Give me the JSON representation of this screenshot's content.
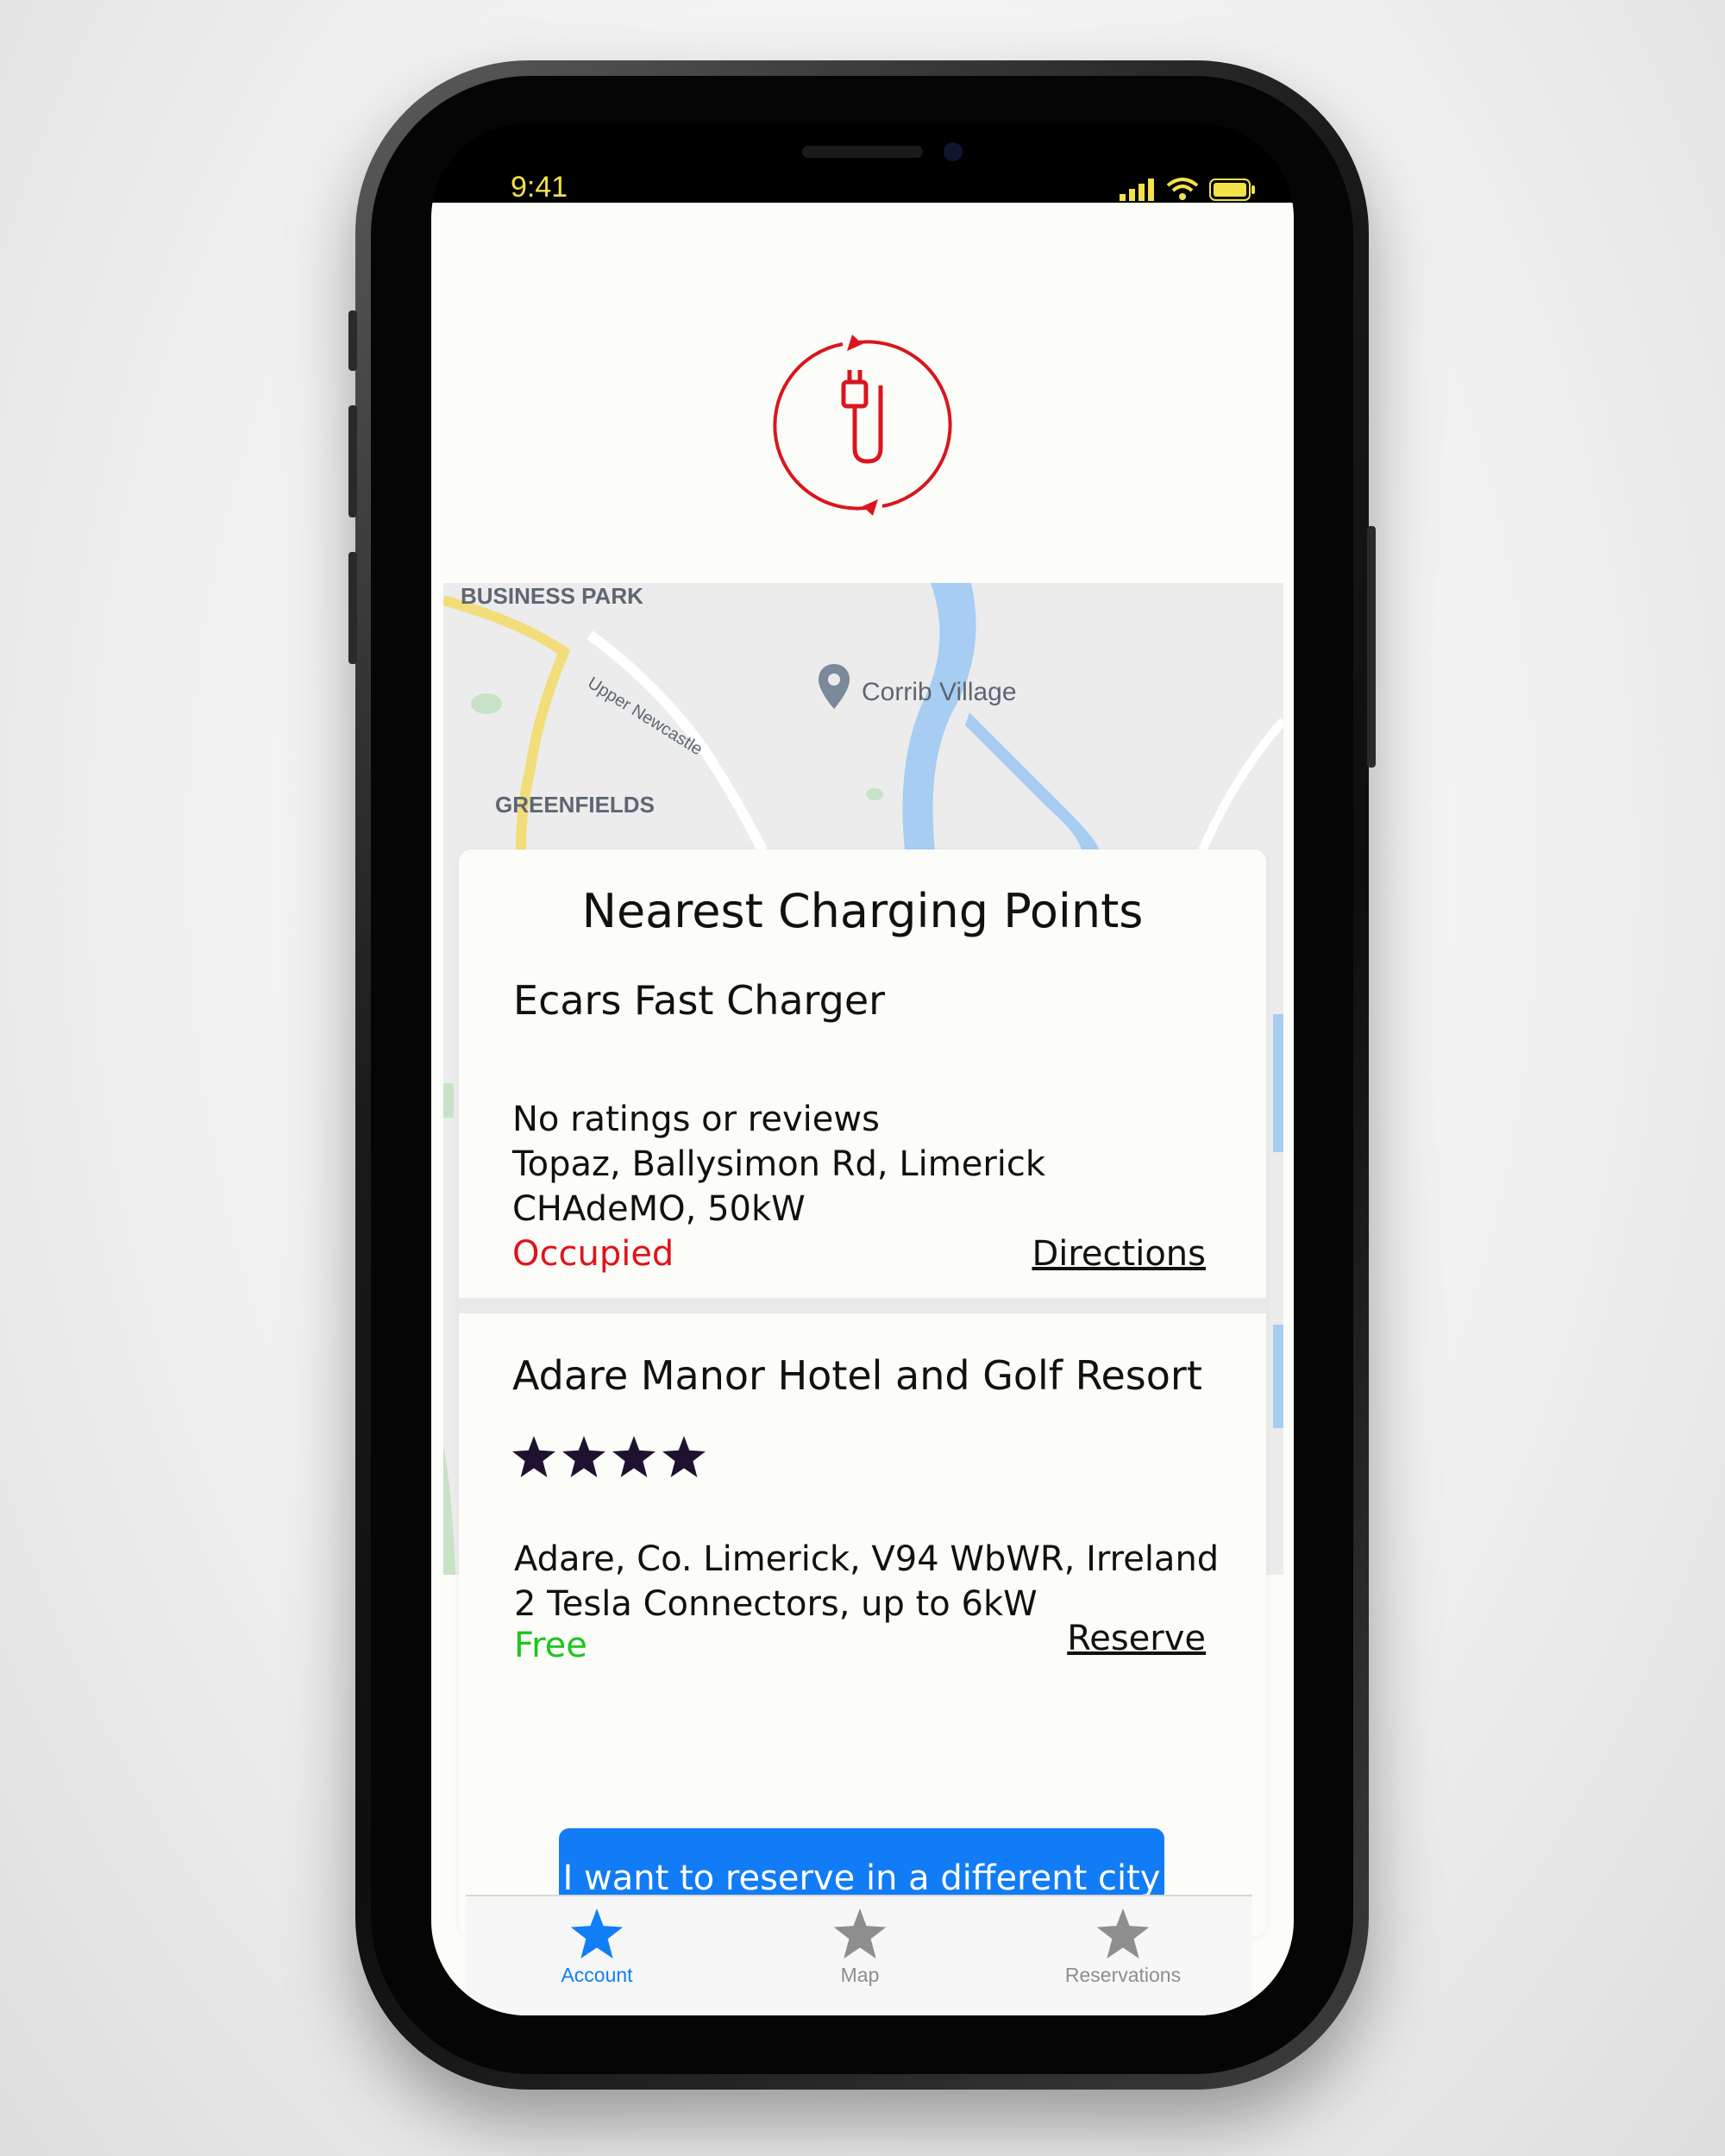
{
  "status_bar": {
    "time": "9:41"
  },
  "map": {
    "labels": {
      "business_park": "BUSINESS PARK",
      "road": "Upper Newcastle",
      "place": "Corrib Village",
      "greenfields": "GREENFIELDS"
    }
  },
  "panel": {
    "title": "Nearest Charging Points",
    "stations": [
      {
        "name": "Ecars Fast Charger",
        "rating_text": "No ratings or reviews",
        "address": "Topaz, Ballysimon Rd, Limerick",
        "connector": "CHAdeMO, 50kW",
        "status": "Occupied",
        "status_color": "#e0131c",
        "action": "Directions"
      },
      {
        "name": "Adare Manor Hotel and Golf Resort",
        "rating": 4,
        "address": "Adare, Co. Limerick, V94 WbWR, Irreland",
        "connector": "2 Tesla Connectors, up to 6kW",
        "status": "Free",
        "status_color": "#1ec41e",
        "action": "Reserve"
      }
    ],
    "cta_button": "I want to reserve in a different city"
  },
  "tab_bar": {
    "tabs": [
      {
        "label": "Account",
        "icon": "star-icon",
        "active": true
      },
      {
        "label": "Map",
        "icon": "star-icon",
        "active": false
      },
      {
        "label": "Reservations",
        "icon": "star-icon",
        "active": false
      }
    ],
    "active_color": "#127ef5",
    "inactive_color": "#8e8e8e"
  },
  "colors": {
    "brand": "#d9161e",
    "accent": "#117cf6",
    "star": "#1f1230"
  }
}
